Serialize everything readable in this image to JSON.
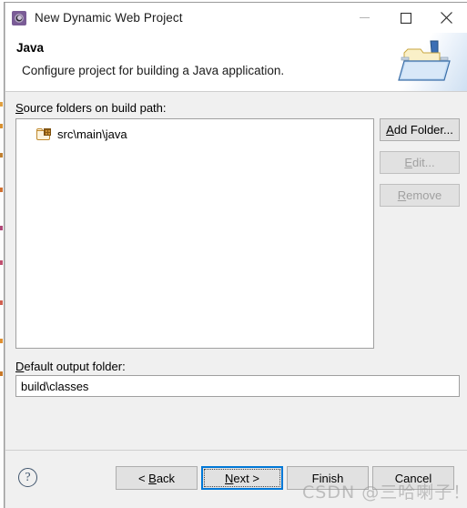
{
  "window": {
    "title": "New Dynamic Web Project",
    "icon": "eclipse-wizard-icon",
    "controls": {
      "minimize": "minimize-icon",
      "maximize": "maximize-icon",
      "close": "close-icon"
    }
  },
  "header": {
    "title": "Java",
    "subtitle": "Configure project for building a Java application.",
    "banner_icon": "java-folder-banner-icon"
  },
  "main": {
    "source_folders_label": "Source folders on build path:",
    "source_folders_label_mnemonic": "S",
    "source_folders": [
      {
        "name": "src\\main\\java",
        "icon": "package-folder-icon"
      }
    ],
    "side_buttons": [
      {
        "label": "Add Folder...",
        "mnemonic": "A",
        "enabled": true
      },
      {
        "label": "Edit...",
        "mnemonic": "E",
        "enabled": false
      },
      {
        "label": "Remove",
        "mnemonic": "R",
        "enabled": false
      }
    ],
    "output_folder_label": "Default output folder:",
    "output_folder_label_mnemonic": "D",
    "output_folder_value": "build\\classes",
    "output_folder_placeholder": ""
  },
  "footer": {
    "help_icon": "help-question-icon",
    "buttons": [
      {
        "label": "< Back",
        "mnemonic": "B",
        "focused": false,
        "enabled": true
      },
      {
        "label": "Next >",
        "mnemonic": "N",
        "focused": true,
        "enabled": true
      },
      {
        "label": "Finish",
        "mnemonic": "",
        "focused": false,
        "enabled": true
      },
      {
        "label": "Cancel",
        "mnemonic": "",
        "focused": false,
        "enabled": true
      }
    ]
  },
  "watermark": "CSDN @三哈喇子！",
  "colors": {
    "dialog_background": "#f0f0f0",
    "field_background": "#ffffff",
    "button_face": "#e1e1e1",
    "button_border": "#adadad",
    "focus_blue": "#0078d7",
    "disabled_text": "#a0a0a0",
    "icon_purple": "#7a5c96",
    "folder_gold": "#c08a2e"
  }
}
